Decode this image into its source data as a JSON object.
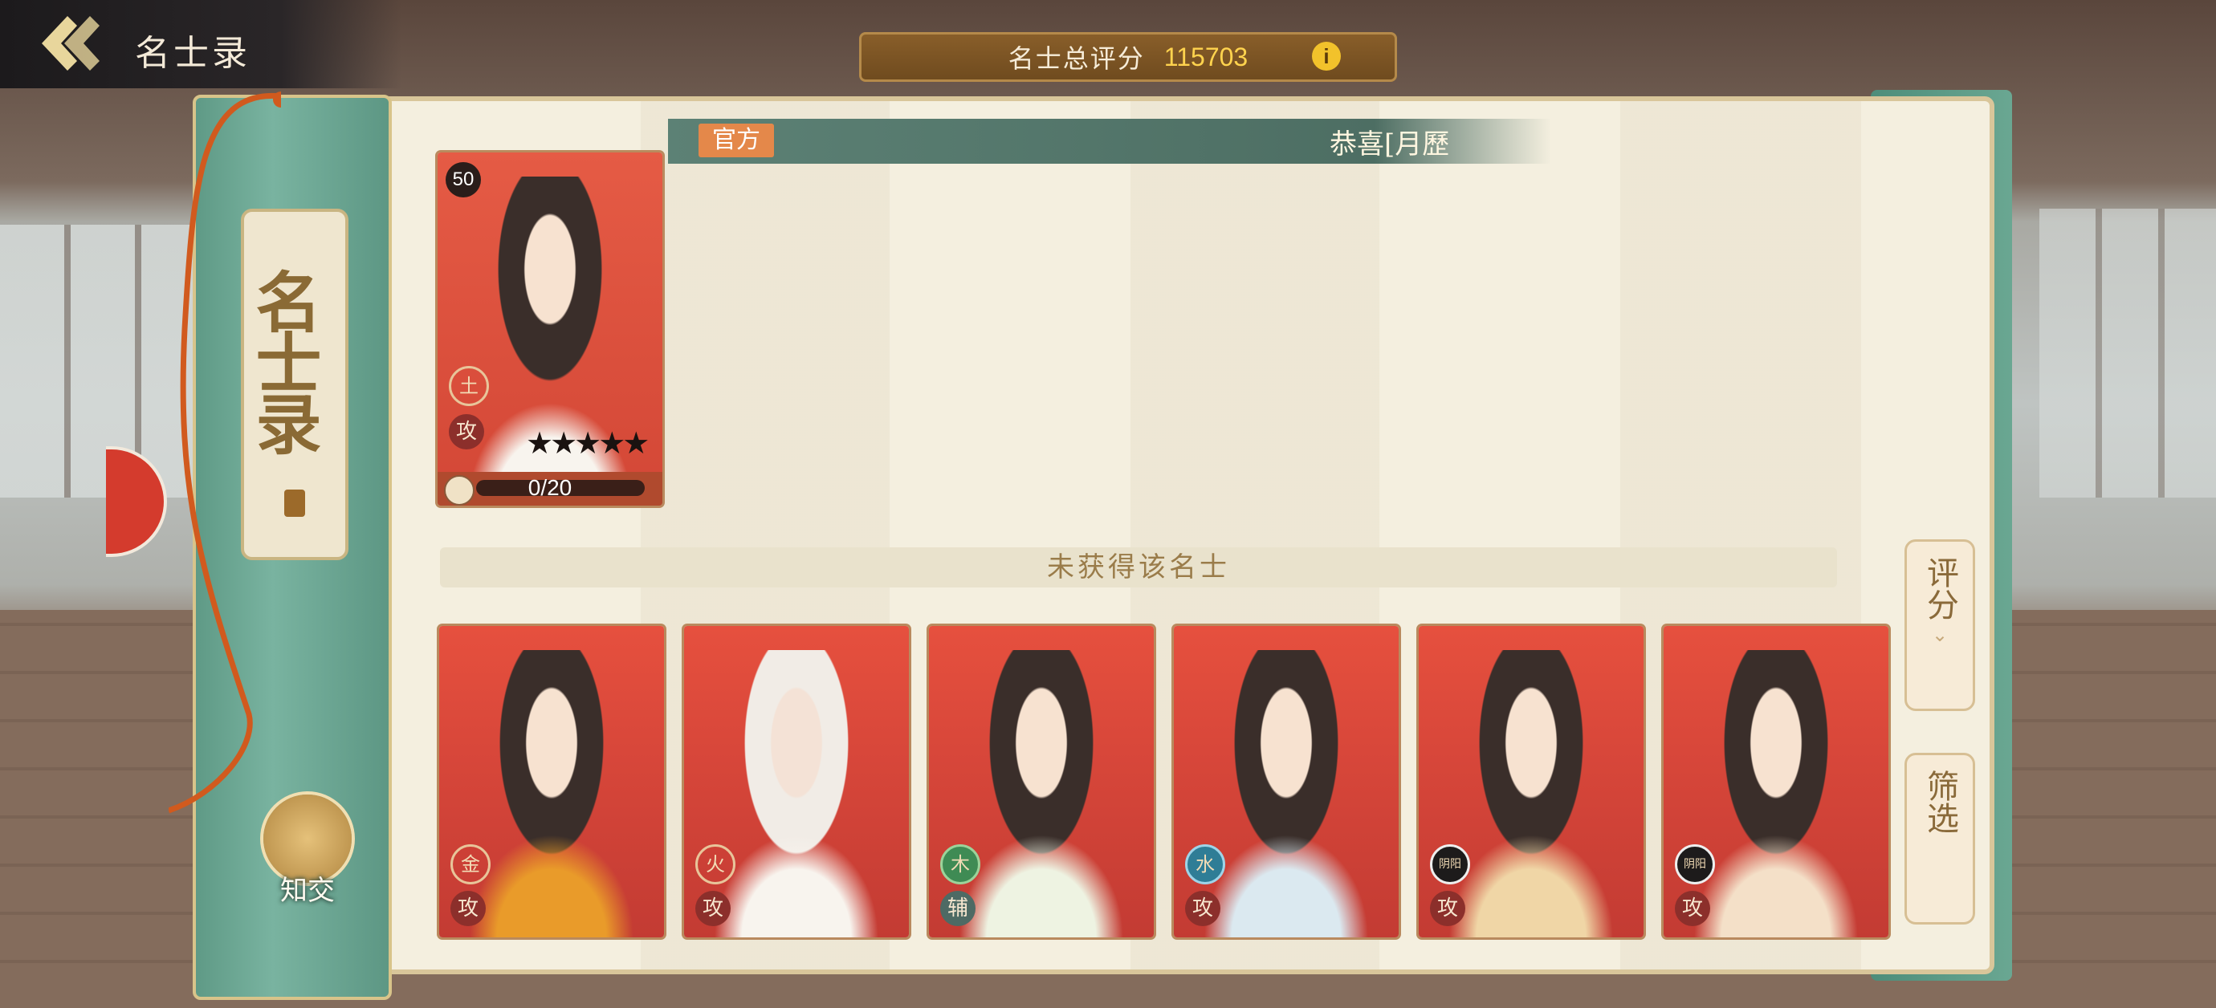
{
  "header": {
    "title": "名士录",
    "score_label": "名士总评分",
    "score_value": "115703",
    "info_icon": "info-icon",
    "back_icon": "back-chevron-icon"
  },
  "sidebar": {
    "spine_title": "名士录",
    "zhijiao_label": "知交",
    "zhijiao_icon": "handshake-icon"
  },
  "marquee": {
    "tag": "官方",
    "text": "恭喜[月歷"
  },
  "owned_card": {
    "level": "50",
    "element": "土",
    "role": "攻",
    "stars": "★★★★★",
    "progress_text": "0/20",
    "progress_fraction": 0
  },
  "section_label": "未获得该名士",
  "locked_cards": [
    {
      "element": "金",
      "role": "攻"
    },
    {
      "element": "火",
      "role": "攻"
    },
    {
      "element": "木",
      "role": "辅"
    },
    {
      "element": "水",
      "role": "攻"
    },
    {
      "element": "阴阳",
      "role": "攻"
    },
    {
      "element": "阴阳",
      "role": "攻"
    }
  ],
  "right_buttons": {
    "score_sort": "评分",
    "filter": "筛选"
  },
  "colors": {
    "accent_gold": "#ffd34e",
    "card_red": "#d8473a",
    "jade": "#6aa792",
    "paper": "#f4efdf"
  }
}
